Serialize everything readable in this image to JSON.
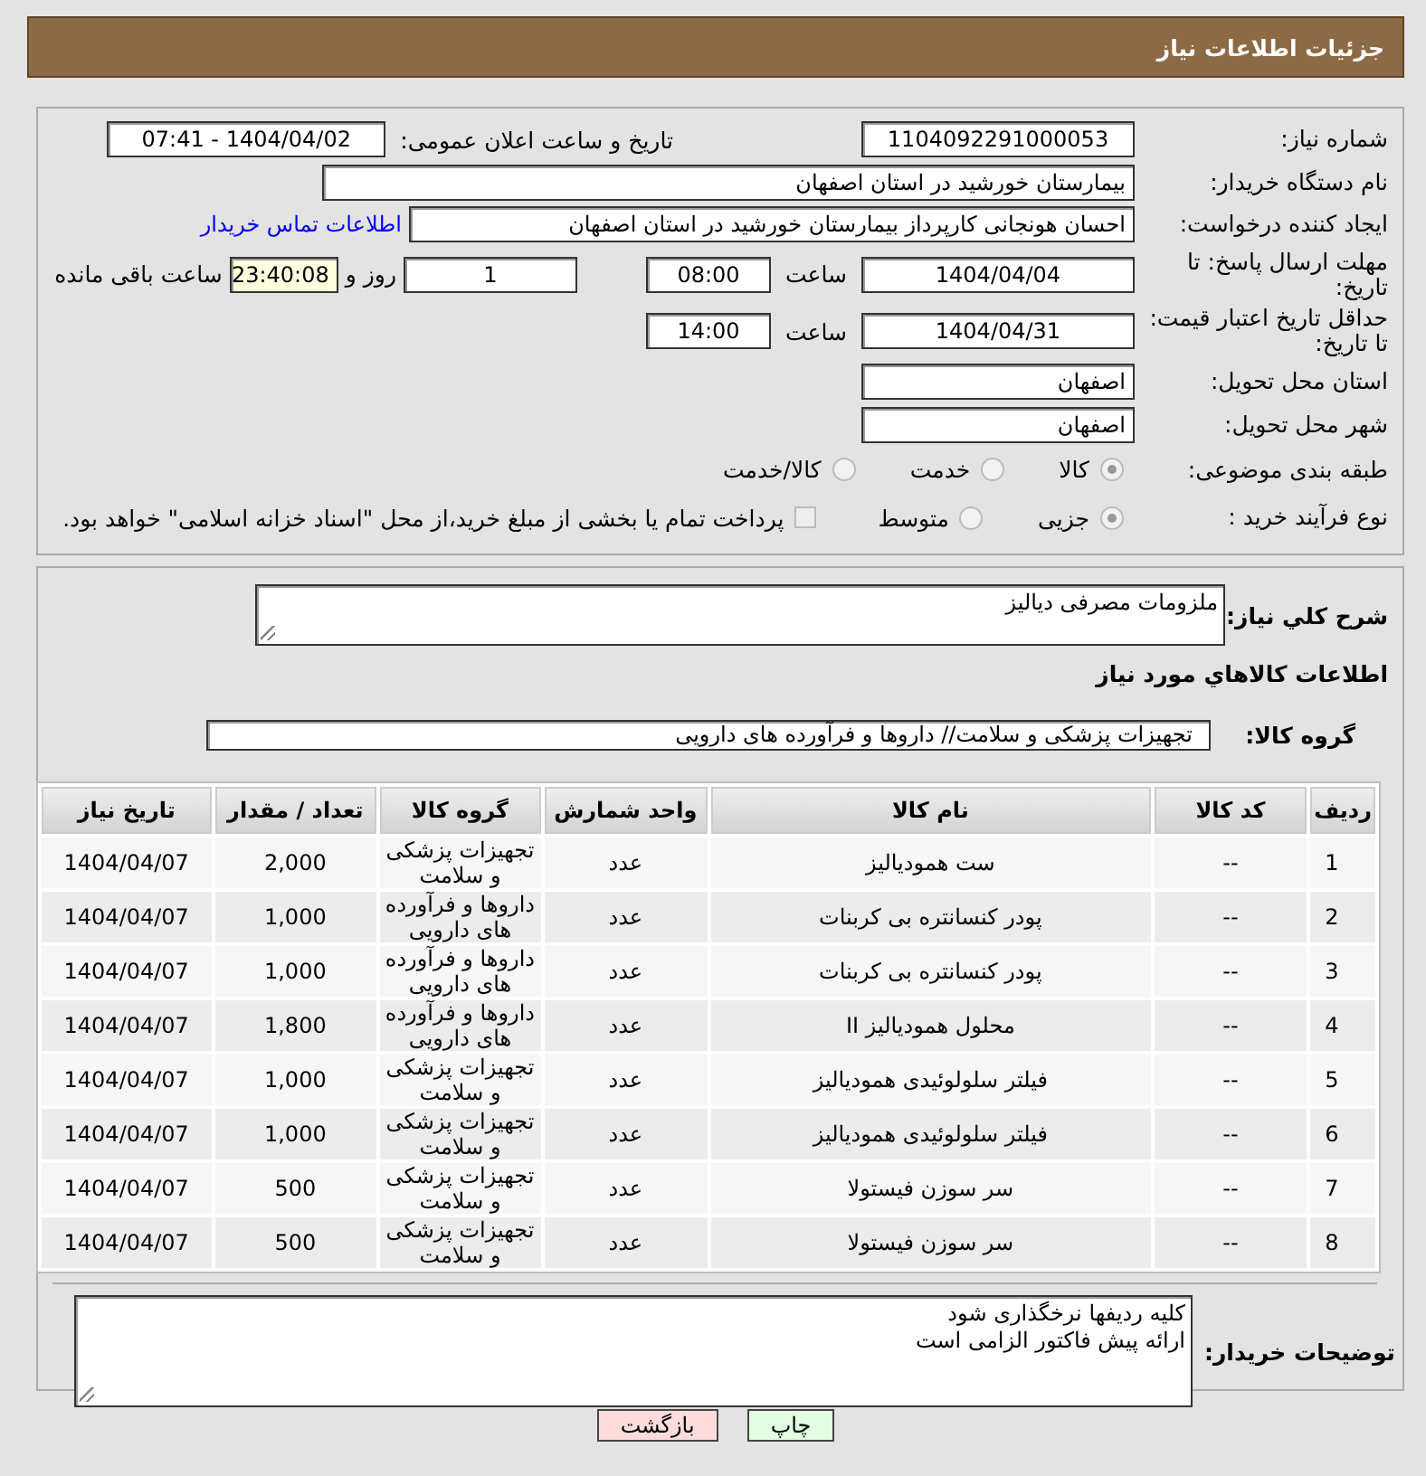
{
  "header": {
    "title": "جزئیات اطلاعات نیاز"
  },
  "need_number": {
    "label": "شماره نیاز:",
    "value": "1104092291000053"
  },
  "announce": {
    "label": "تاریخ و ساعت اعلان عمومی:",
    "value": "1404/04/02 - 07:41"
  },
  "buyer": {
    "label": "نام دستگاه خریدار:",
    "value": "بیمارستان خورشید در استان اصفهان"
  },
  "requester": {
    "label": "ایجاد کننده درخواست:",
    "value": "احسان هونجانی کارپرداز بیمارستان خورشید در استان اصفهان",
    "link": "اطلاعات تماس خریدار"
  },
  "reply_deadline": {
    "label": "مهلت ارسال پاسخ: تا تاریخ:",
    "date": "1404/04/04",
    "time_label": "ساعت",
    "time": "08:00",
    "days": "1",
    "days_label": "روز و",
    "remaining": "23:40:08",
    "remaining_label": "ساعت باقی مانده"
  },
  "price_validity": {
    "label": "حداقل تاریخ اعتبار قیمت: تا تاریخ:",
    "date": "1404/04/31",
    "time_label": "ساعت",
    "time": "14:00"
  },
  "province": {
    "label": "استان محل تحویل:",
    "value": "اصفهان"
  },
  "city": {
    "label": "شهر محل تحویل:",
    "value": "اصفهان"
  },
  "category": {
    "label": "طبقه بندی موضوعی:",
    "options": [
      {
        "label": "کالا",
        "selected": true
      },
      {
        "label": "خدمت",
        "selected": false
      },
      {
        "label": "کالا/خدمت",
        "selected": false
      }
    ]
  },
  "process": {
    "label": "نوع فرآیند خرید :",
    "options": [
      {
        "label": "جزیی",
        "selected": true
      },
      {
        "label": "متوسط",
        "selected": false
      }
    ],
    "payment": {
      "label": "پرداخت تمام یا بخشی از مبلغ خرید،از محل \"اسناد خزانه اسلامی\" خواهد بود.",
      "checked": false
    }
  },
  "description": {
    "label": "شرح کلي نياز:",
    "value": "ملزومات مصرفی دیالیز"
  },
  "goods_heading": "اطلاعات کالاهاي مورد نياز",
  "goods_group": {
    "label": "گروه کالا:",
    "value": "تجهیزات پزشکی و سلامت// داروها و فرآورده های دارویی"
  },
  "table": {
    "columns": [
      "ردیف",
      "کد کالا",
      "نام کالا",
      "واحد شمارش",
      "گروه کالا",
      "تعداد / مقدار",
      "تاریخ نیاز"
    ],
    "rows": [
      [
        "1",
        "--",
        "ست همودیالیز",
        "عدد",
        "تجهیزات پزشکی و سلامت",
        "2,000",
        "1404/04/07"
      ],
      [
        "2",
        "--",
        "پودر کنسانتره بی کربنات",
        "عدد",
        "داروها و فرآورده های دارویی",
        "1,000",
        "1404/04/07"
      ],
      [
        "3",
        "--",
        "پودر کنسانتره بی کربنات",
        "عدد",
        "داروها و فرآورده های دارویی",
        "1,000",
        "1404/04/07"
      ],
      [
        "4",
        "--",
        "محلول همودیالیز II",
        "عدد",
        "داروها و فرآورده های دارویی",
        "1,800",
        "1404/04/07"
      ],
      [
        "5",
        "--",
        "فیلتر سلولوئیدی همودیالیز",
        "عدد",
        "تجهیزات پزشکی و سلامت",
        "1,000",
        "1404/04/07"
      ],
      [
        "6",
        "--",
        "فیلتر سلولوئیدی همودیالیز",
        "عدد",
        "تجهیزات پزشکی و سلامت",
        "1,000",
        "1404/04/07"
      ],
      [
        "7",
        "--",
        "سر سوزن فیستولا",
        "عدد",
        "تجهیزات پزشکی و سلامت",
        "500",
        "1404/04/07"
      ],
      [
        "8",
        "--",
        "سر سوزن فیستولا",
        "عدد",
        "تجهیزات پزشکی و سلامت",
        "500",
        "1404/04/07"
      ]
    ]
  },
  "buyer_notes": {
    "label": "توضیحات خریدار:",
    "lines": [
      "کلیه ردیفها نرخگذاری شود",
      "ارائه پیش فاکتور الزامی است"
    ]
  },
  "buttons": [
    {
      "label": "چاپ",
      "kind": "print"
    },
    {
      "label": "بازگشت",
      "kind": "back"
    }
  ]
}
